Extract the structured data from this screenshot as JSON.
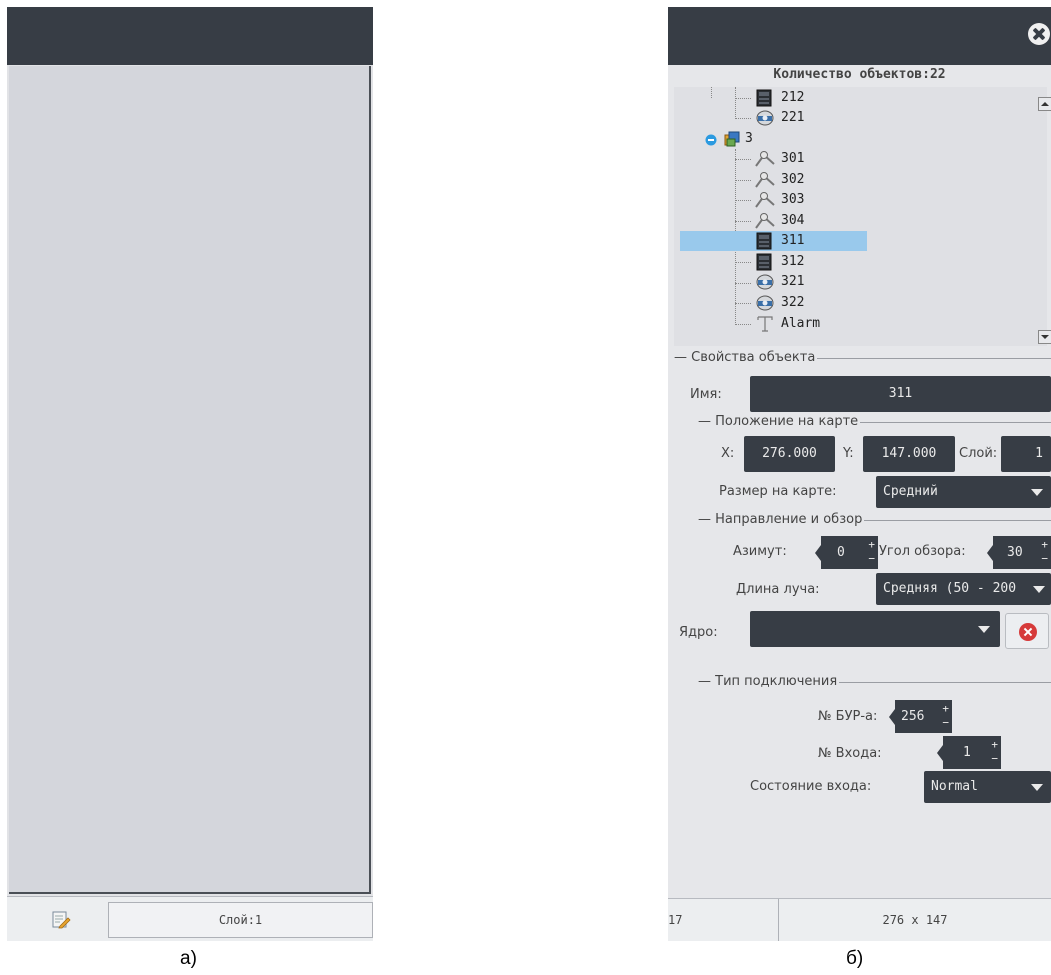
{
  "panel_a": {
    "figure_label": "а)",
    "status_layer": "Слой:1",
    "status_icon": "edit-note-icon"
  },
  "panel_b": {
    "figure_label": "б)",
    "object_count": "Количество объектов:22",
    "tree": [
      {
        "label": "212",
        "icon": "panel-device-icon"
      },
      {
        "label": "221",
        "icon": "camera-icon"
      },
      {
        "label": "3",
        "icon": "group-folder-icon"
      },
      {
        "label": "301",
        "icon": "sensor-icon"
      },
      {
        "label": "302",
        "icon": "sensor-icon"
      },
      {
        "label": "303",
        "icon": "sensor-icon"
      },
      {
        "label": "304",
        "icon": "sensor-icon"
      },
      {
        "label": "311",
        "icon": "panel-device-icon",
        "selected": true
      },
      {
        "label": "312",
        "icon": "panel-device-icon"
      },
      {
        "label": "321",
        "icon": "camera-icon"
      },
      {
        "label": "322",
        "icon": "camera-icon"
      },
      {
        "label": "Alarm",
        "icon": "text-icon"
      }
    ],
    "properties": {
      "section_title": "Свойства объекта",
      "name_label": "Имя:",
      "name_value": "311",
      "position": {
        "section_title": "Положение на карте",
        "x_label": "X:",
        "x_value": "276.000",
        "y_label": "Y:",
        "y_value": "147.000",
        "layer_label": "Слой:",
        "layer_value": "1",
        "size_label": "Размер на карте:",
        "size_value": "Средний"
      },
      "direction": {
        "section_title": "Направление и обзор",
        "azimuth_label": "Азимут:",
        "azimuth_value": "0",
        "view_angle_label": "Угол обзора:",
        "view_angle_value": "30",
        "beam_label": "Длина луча:",
        "beam_value": "Средняя (50 - 200"
      },
      "core_label": "Ядро:",
      "core_value": ""
    },
    "connection": {
      "section_title": "Тип подключения",
      "bur_label": "№ БУР-а:",
      "bur_value": "256",
      "input_label": "№ Входа:",
      "input_value": "1",
      "input_state_label": "Состояние входа:",
      "input_state_value": "Normal"
    },
    "status_left": "17",
    "status_coords": "276 x 147"
  }
}
